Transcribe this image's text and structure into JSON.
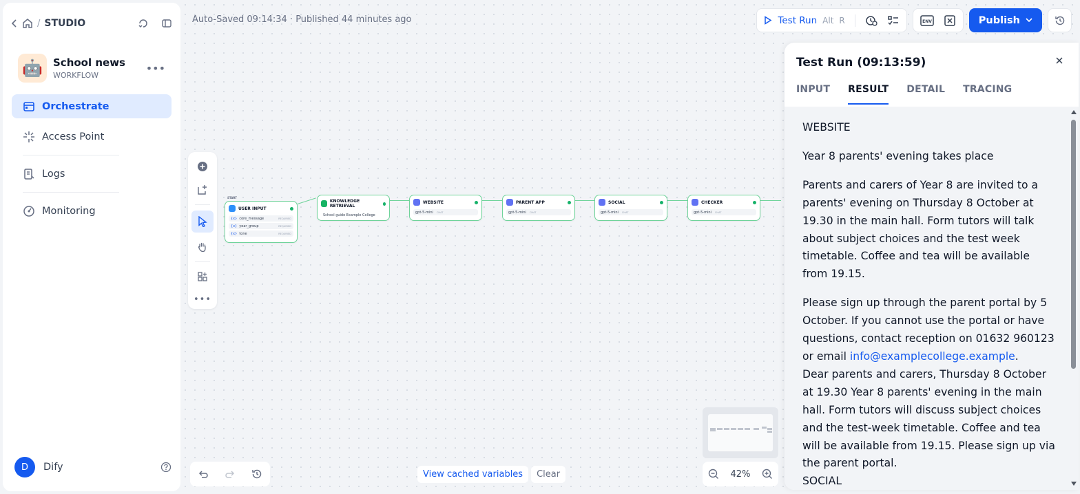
{
  "breadcrumb": {
    "section": "STUDIO",
    "separator": "/"
  },
  "app": {
    "icon": "🤖",
    "name": "School news",
    "type": "WORKFLOW"
  },
  "sidebar": {
    "items": [
      {
        "label": "Orchestrate",
        "icon": "orchestrate-icon",
        "active": true
      },
      {
        "label": "Access Point",
        "icon": "access-point-icon",
        "active": false
      },
      {
        "label": "Logs",
        "icon": "logs-icon",
        "active": false
      },
      {
        "label": "Monitoring",
        "icon": "monitoring-icon",
        "active": false
      }
    ]
  },
  "user": {
    "initial": "D",
    "name": "Dify"
  },
  "header": {
    "autosave": "Auto-Saved 09:14:34 · Published 44 minutes ago",
    "test_run_label": "Test Run",
    "test_run_shortcut_1": "Alt",
    "test_run_shortcut_2": "R",
    "env_label": "ENV",
    "publish_label": "Publish"
  },
  "workflow": {
    "start_label": "START",
    "nodes": [
      {
        "title": "USER INPUT",
        "rows": [
          {
            "prefix": "{x}",
            "name": "core_message",
            "tag": "REQUIRED"
          },
          {
            "prefix": "{x}",
            "name": "year_group",
            "tag": "REQUIRED"
          },
          {
            "prefix": "{x}",
            "name": "tone",
            "tag": "REQUIRED"
          }
        ]
      },
      {
        "title": "KNOWLEDGE RETRIEVAL",
        "rows": [
          {
            "prefix": "",
            "name": "School guide Example College",
            "tag": ""
          }
        ]
      },
      {
        "title": "WEBSITE",
        "rows": [
          {
            "prefix": "",
            "name": "gpt-5-mini",
            "tag": "CHAT"
          }
        ]
      },
      {
        "title": "PARENT APP",
        "rows": [
          {
            "prefix": "",
            "name": "gpt-5-mini",
            "tag": "CHAT"
          }
        ]
      },
      {
        "title": "SOCIAL",
        "rows": [
          {
            "prefix": "",
            "name": "gpt-5-mini",
            "tag": "CHAT"
          }
        ]
      },
      {
        "title": "CHECKER",
        "rows": [
          {
            "prefix": "",
            "name": "gpt-5-mini",
            "tag": "CHAT"
          }
        ]
      }
    ]
  },
  "canvas": {
    "view_cached_label": "View cached variables",
    "clear_label": "Clear",
    "zoom": "42%"
  },
  "test_run_panel": {
    "title": "Test Run (09:13:59)",
    "tabs": [
      {
        "label": "INPUT",
        "active": false
      },
      {
        "label": "RESULT",
        "active": true
      },
      {
        "label": "DETAIL",
        "active": false
      },
      {
        "label": "TRACING",
        "active": false
      }
    ],
    "result": {
      "heading_1": "WEBSITE",
      "headline": "Year 8 parents' evening takes place",
      "para_1": "Parents and carers of Year 8 are invited to a parents' evening on Thursday 8 October at 19.30 in the main hall. Form tutors will talk about subject choices and the test week timetable. Coffee and tea will be available from 19.15.",
      "para_2_before_link": "Please sign up through the parent portal by 5 October. If you cannot use the portal or have questions, contact reception on 01632 960123 or email ",
      "para_2_link": "info@examplecollege.example",
      "para_2_after_link": ".",
      "para_3": "Dear parents and carers, Thursday 8 October at 19.30 Year 8 parents' evening in the main hall. Form tutors will discuss subject choices and the test-week timetable. Coffee and tea will be available from 19.15. Please sign up via the parent portal.",
      "heading_2": "SOCIAL"
    }
  },
  "colors": {
    "accent": "#155aef",
    "node_border": "#6fd39a",
    "success": "#17b26a"
  }
}
